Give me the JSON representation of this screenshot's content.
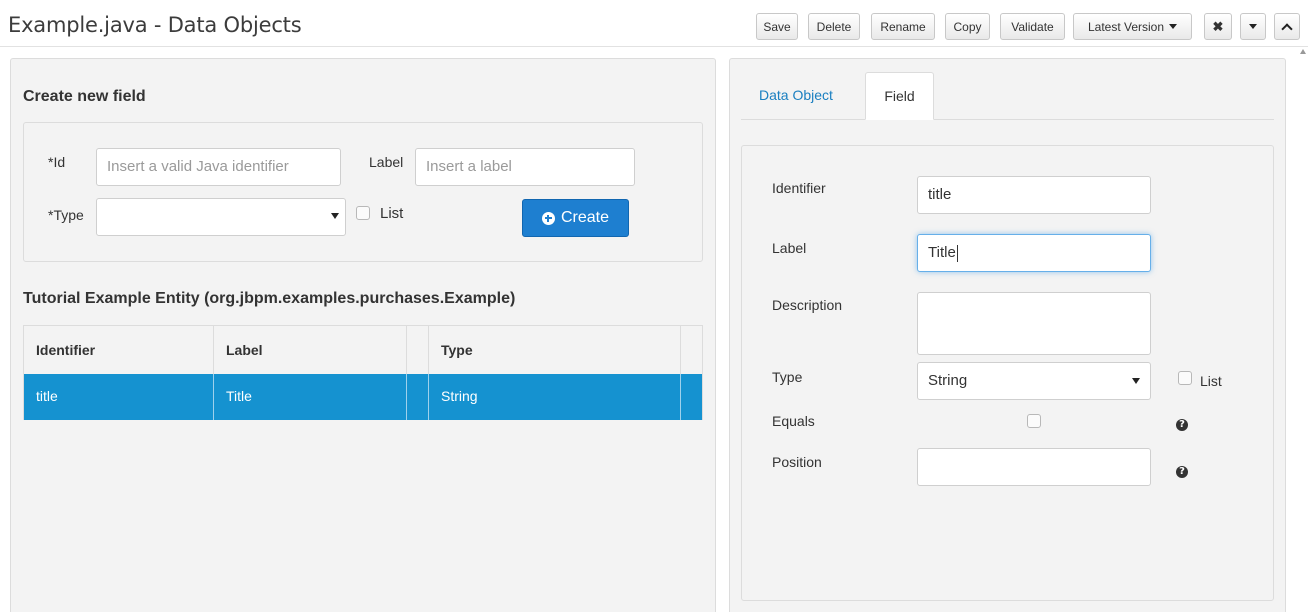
{
  "header": {
    "title": "Example.java - Data Objects",
    "toolbar": {
      "save": "Save",
      "delete": "Delete",
      "rename": "Rename",
      "copy": "Copy",
      "validate": "Validate",
      "latest_version": "Latest Version"
    },
    "icons": [
      "close-icon",
      "caret-down-icon",
      "chevron-up-icon"
    ]
  },
  "create_field": {
    "heading": "Create new field",
    "id_label": "*Id",
    "id_placeholder": "Insert a valid Java identifier",
    "label_label": "Label",
    "label_placeholder": "Insert a label",
    "type_label": "*Type",
    "type_value": "",
    "list_label": "List",
    "create_button": "Create"
  },
  "entity": {
    "heading": "Tutorial Example Entity (org.jbpm.examples.purchases.Example)",
    "columns": [
      "Identifier",
      "Label",
      "",
      "Type",
      ""
    ],
    "rows": [
      {
        "identifier": "title",
        "label": "Title",
        "type": "String"
      }
    ]
  },
  "tabs": {
    "data_object": "Data Object",
    "field": "Field",
    "active": "field"
  },
  "field_editor": {
    "identifier_label": "Identifier",
    "identifier_value": "title",
    "label_label": "Label",
    "label_value": "Title",
    "description_label": "Description",
    "description_value": "",
    "type_label": "Type",
    "type_value": "String",
    "list_label": "List",
    "equals_label": "Equals",
    "position_label": "Position",
    "position_value": ""
  },
  "colors": {
    "primary_button": "#1e7fd0",
    "selected_row": "#1592d0",
    "link": "#1a7fc0",
    "panel_background": "#f3f3f3"
  }
}
